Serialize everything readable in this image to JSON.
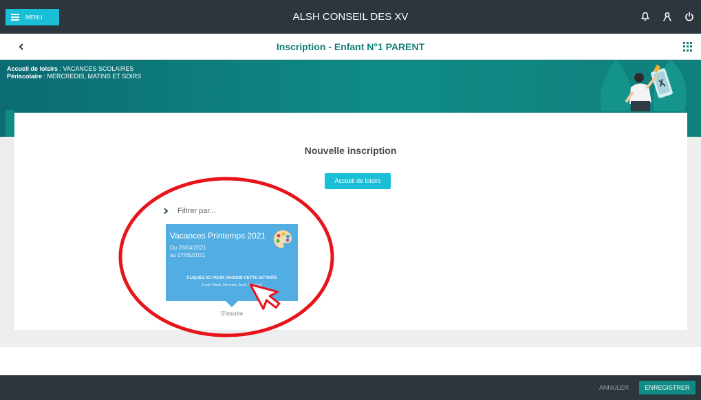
{
  "topbar": {
    "menu_label": "MENU",
    "app_title": "ALSH CONSEIL DES XV",
    "icons": [
      "bell-icon",
      "user-icon",
      "power-icon"
    ]
  },
  "subheader": {
    "title": "Inscription  -  Enfant N°1 PARENT"
  },
  "banner": {
    "line1_bold": "Accueil de loisirs",
    "line1_rest": " : VACANCES SCOLAIRES",
    "line2_bold": "Périscolaire",
    "line2_rest": " : MERCREDIS, MATINS ET SOIRS"
  },
  "main": {
    "section_title": "Nouvelle inscription",
    "accueil_button": "Accueil de loisirs",
    "filter_label": "Filtrer par..."
  },
  "activity": {
    "title": "Vacances Printemps 2021",
    "date_from": "Du 26/04/2021",
    "date_to": "au 07/05/2021",
    "cta": "CLIQUEZ ICI POUR CHOISIR CETTE ACTIVITE",
    "days": "Lundi, Mardi, Mercredi, Jeudi, Vendredi",
    "action_label": "S'inscrire"
  },
  "footer": {
    "cancel_label": "ANNULER",
    "save_label": "ENREGISTRER"
  },
  "colors": {
    "topbar": "#2d363d",
    "accent": "#19bfd6",
    "teal": "#0f8b85",
    "card": "#52ade3",
    "highlight": "#e8141b"
  }
}
